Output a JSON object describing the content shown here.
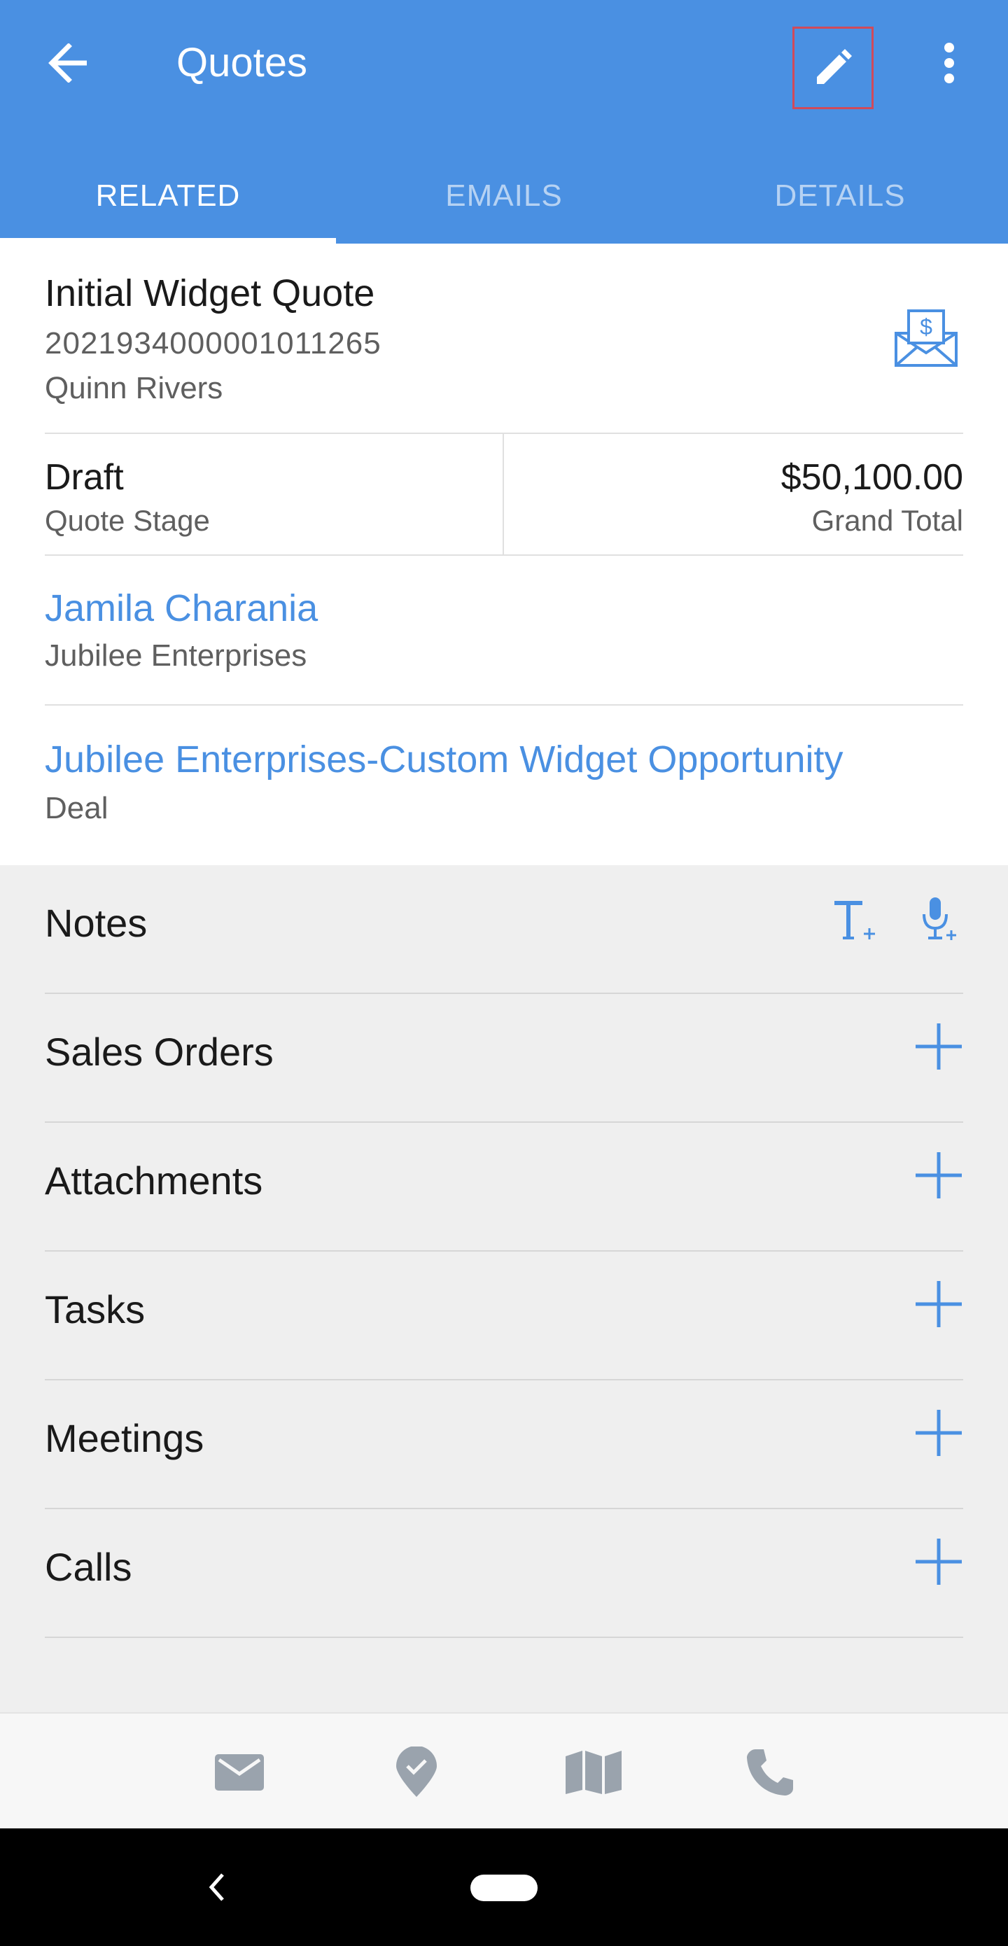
{
  "app_bar": {
    "title": "Quotes",
    "icons": [
      "back-arrow-icon",
      "edit-pencil-icon",
      "more-vert-icon"
    ]
  },
  "tabs": [
    {
      "label": "RELATED",
      "active": true
    },
    {
      "label": "EMAILS",
      "active": false
    },
    {
      "label": "DETAILS",
      "active": false
    }
  ],
  "record": {
    "title": "Initial Widget Quote",
    "number": "2021934000001011265",
    "owner": "Quinn Rivers",
    "stage_value": "Draft",
    "stage_label": "Quote Stage",
    "total_value": "$50,100.00",
    "total_label": "Grand Total",
    "contact_name": "Jamila Charania",
    "contact_account": "Jubilee Enterprises",
    "deal_name": "Jubilee Enterprises-Custom Widget Opportunity",
    "deal_label": "Deal"
  },
  "related_lists": [
    {
      "label": "Notes"
    },
    {
      "label": "Sales Orders"
    },
    {
      "label": "Attachments"
    },
    {
      "label": "Tasks"
    },
    {
      "label": "Meetings"
    },
    {
      "label": "Calls"
    }
  ],
  "action_bar": {
    "icons": [
      "email-icon",
      "check-in-location-icon",
      "map-icon",
      "phone-icon"
    ]
  },
  "colors": {
    "primary": "#4a90e2",
    "highlight_border": "#d04a5a",
    "action_icon": "#9aa3ad"
  }
}
